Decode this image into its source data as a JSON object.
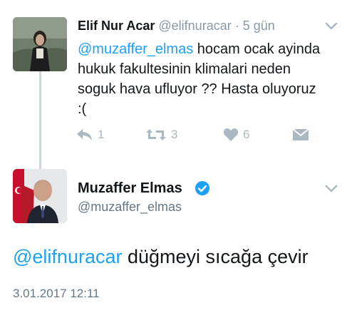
{
  "tweet1": {
    "name": "Elif Nur Acar",
    "handle": "@elifnuracar",
    "separator": "·",
    "time": "5 gün",
    "mention": "@muzaffer_elmas",
    "text": " hocam ocak ayinda hukuk fakultesinin klimalari neden soguk hava ufluyor ?? Hasta oluyoruz :(",
    "actions": {
      "reply_count": "1",
      "retweet_count": "3",
      "like_count": "6"
    },
    "icons": [
      "reply-icon",
      "retweet-icon",
      "heart-icon",
      "direct-message-icon",
      "chevron-down-icon"
    ]
  },
  "tweet2": {
    "name": "Muzaffer Elmas",
    "handle": "@muzaffer_elmas",
    "mention": "@elifnuracar",
    "text": " düğmeyi sıcağa çevir",
    "timestamp": "3.01.2017 12:11",
    "icons": [
      "verified-badge-icon",
      "chevron-down-icon"
    ]
  },
  "colors": {
    "link": "#1da1f2",
    "muted": "#8899a6",
    "action": "#aab8c2",
    "text": "#14171a"
  }
}
